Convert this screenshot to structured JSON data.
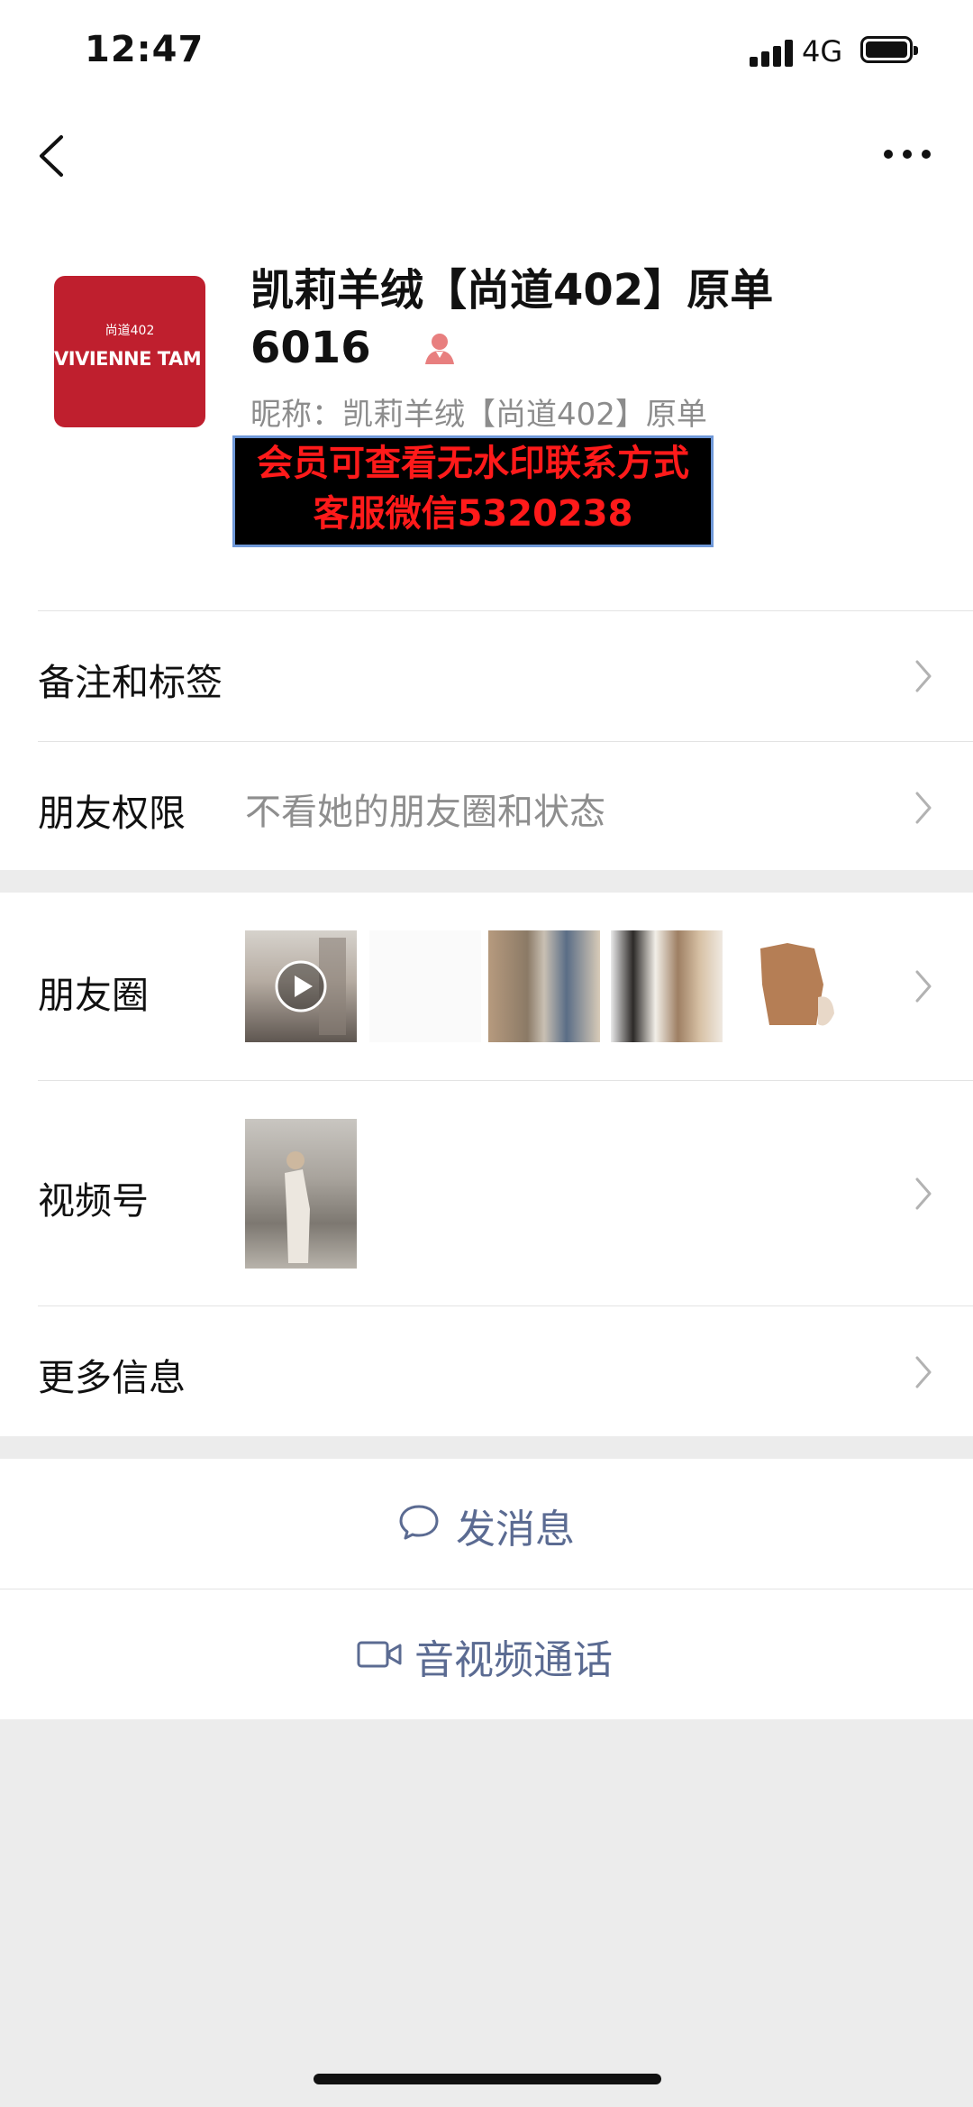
{
  "status_bar": {
    "time": "12:47",
    "network": "4G"
  },
  "nav": {
    "back_icon": "chevron-left-icon",
    "more_icon": "more-dots-icon"
  },
  "profile": {
    "avatar": {
      "small_text": "尚道402",
      "brand_text": "VIVIENNE TAM",
      "color": "#bf1f2e"
    },
    "name_line1": "凯莉羊绒【尚道402】原单",
    "name_line2": "6016",
    "nickname": "昵称：凯莉羊绒【尚道402】原单",
    "watermark": {
      "line1": "会员可查看无水印联系方式",
      "line2": "客服微信5320238"
    }
  },
  "rows": {
    "remark": {
      "label": "备注和标签"
    },
    "permission": {
      "label": "朋友权限",
      "value": "不看她的朋友圈和状态"
    },
    "moments": {
      "label": "朋友圈"
    },
    "channels": {
      "label": "视频号"
    },
    "more_info": {
      "label": "更多信息"
    }
  },
  "actions": {
    "message": {
      "label": "发消息",
      "icon": "chat-bubble-icon"
    },
    "call": {
      "label": "音视频通话",
      "icon": "video-camera-icon"
    }
  },
  "colors": {
    "accent": "#5b6b92",
    "background": "#ececec"
  }
}
